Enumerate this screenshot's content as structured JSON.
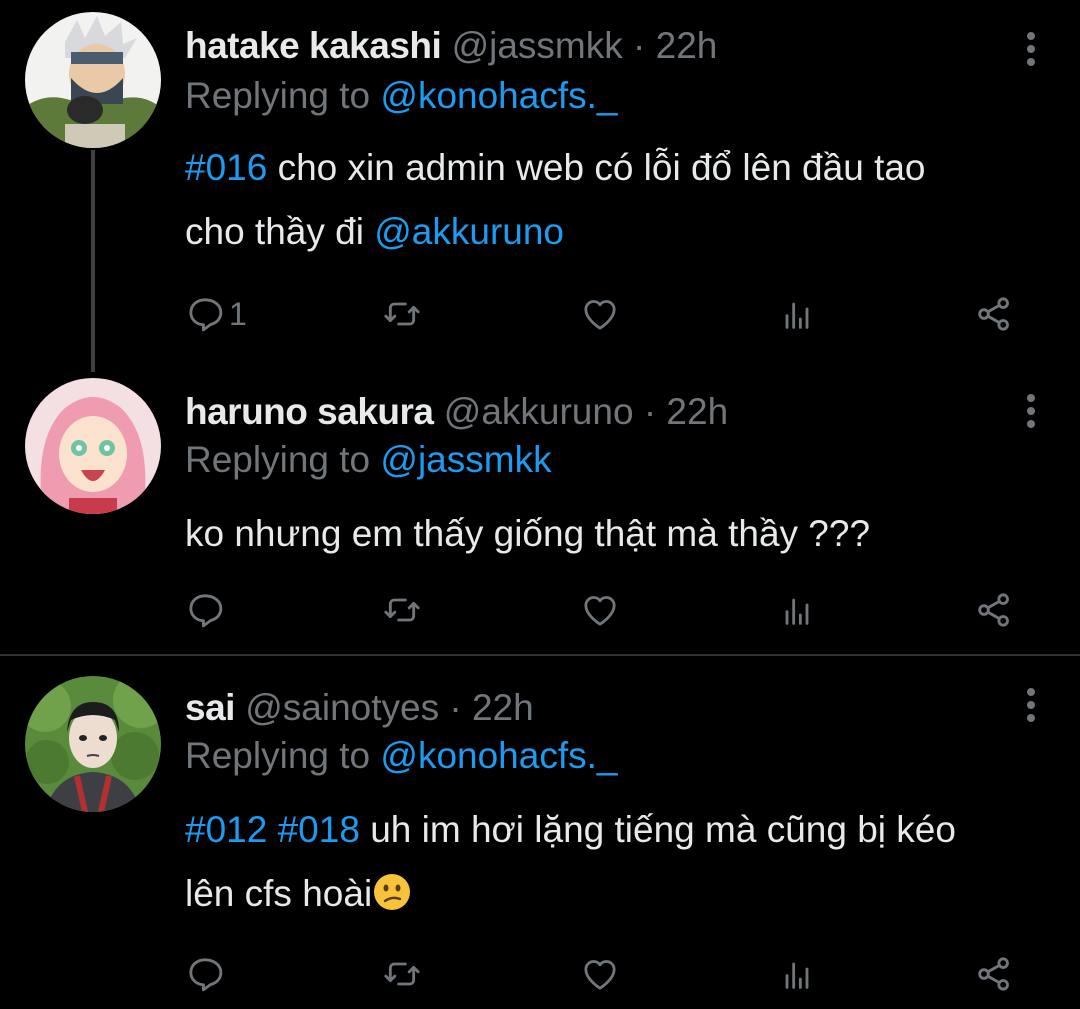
{
  "tweets": [
    {
      "name": "hatake kakashi",
      "handle": "@jassmkk",
      "time": "· 22h",
      "replying_prefix": "Replying to",
      "replying_to": "@konohacfs._",
      "hashtags": "#016",
      "text_line1": "cho xin admin web có lỗi đổ lên đầu tao",
      "text_line2": "cho thầy đi",
      "mention": "@akkuruno",
      "reply_count": "1"
    },
    {
      "name": "haruno sakura",
      "handle": "@akkuruno",
      "time": "· 22h",
      "replying_prefix": "Replying to",
      "replying_to": "@jassmkk",
      "text_line1": "ko nhưng em thấy giống thật mà thầy ???"
    },
    {
      "name": "sai",
      "handle": "@sainotyes",
      "time": "· 22h",
      "replying_prefix": "Replying to",
      "replying_to": "@konohacfs._",
      "hashtags": "#012 #018",
      "text_line1": "uh im hơi lặng tiếng mà cũng bị kéo",
      "text_line2": "lên cfs hoài"
    }
  ],
  "icons": {
    "reply": "speech-bubble-icon",
    "retweet": "retweet-icon",
    "like": "heart-icon",
    "analytics": "bar-chart-icon",
    "share": "share-icon",
    "more": "more-vertical-icon",
    "emoji": "confused-face-emoji"
  },
  "colors": {
    "background": "#000000",
    "text": "#e7e9ea",
    "muted": "#71767b",
    "link": "#1d9bf0",
    "divider": "#2f3336"
  }
}
